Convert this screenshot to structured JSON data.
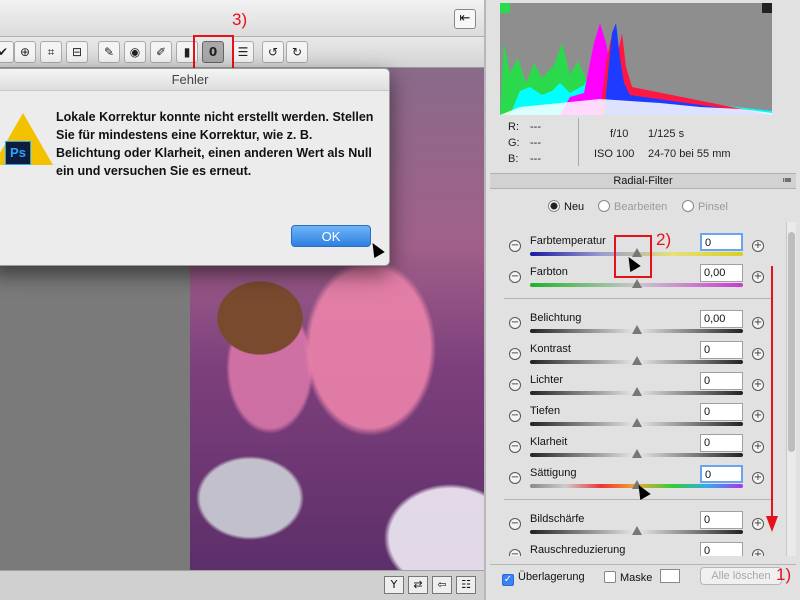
{
  "window": {
    "exit_icon": "⇤"
  },
  "toolbar": {
    "tools": [
      {
        "name": "tool-brush-partial",
        "glyph": "✔"
      },
      {
        "name": "tool-target-adjust",
        "glyph": "⊕"
      },
      {
        "name": "tool-crop",
        "glyph": "⌗"
      },
      {
        "name": "tool-straighten",
        "glyph": "⊟"
      },
      {
        "name": "tool-spot-removal",
        "glyph": "✎"
      },
      {
        "name": "tool-red-eye",
        "glyph": "◉"
      },
      {
        "name": "tool-adjustment-brush",
        "glyph": "✐"
      },
      {
        "name": "tool-graduated-filter",
        "glyph": "▮"
      },
      {
        "name": "tool-radial-filter",
        "glyph": "0"
      },
      {
        "name": "tool-preferences",
        "glyph": "☰"
      },
      {
        "name": "tool-rotate-left",
        "glyph": "↺"
      },
      {
        "name": "tool-rotate-right",
        "glyph": "↻"
      }
    ]
  },
  "annotations": {
    "label_1": "1)",
    "label_2": "2)",
    "label_3": "3)"
  },
  "dialog": {
    "title": "Fehler",
    "message": "Lokale Korrektur konnte nicht erstellt werden. Stellen Sie für mindestens eine Korrektur, wie z. B. Belichtung oder Klarheit, einen anderen Wert als Null ein und versuchen Sie es erneut.",
    "ok_label": "OK",
    "ps_badge": "Ps"
  },
  "status_buttons": [
    "Y",
    "⇄",
    "⇦",
    "☷"
  ],
  "info": {
    "r_label": "R:",
    "r_value": "---",
    "g_label": "G:",
    "g_value": "---",
    "b_label": "B:",
    "b_value": "---",
    "aperture": "f/10",
    "shutter": "1/125 s",
    "iso": "ISO 100",
    "lens": "24-70 bei 55 mm"
  },
  "panel": {
    "title": "Radial-Filter",
    "menu_icon": "≔",
    "modes": [
      {
        "label": "Neu",
        "selected": true,
        "enabled": true
      },
      {
        "label": "Bearbeiten",
        "selected": false,
        "enabled": false
      },
      {
        "label": "Pinsel",
        "selected": false,
        "enabled": false
      }
    ],
    "sliders": [
      {
        "label": "Farbtemperatur",
        "value": "0",
        "level": 0.5,
        "track": "temp",
        "focus": true
      },
      {
        "label": "Farbton",
        "value": "0,00",
        "level": 0.5,
        "track": "tint",
        "focus": false
      },
      {
        "label": "Belichtung",
        "value": "0,00",
        "level": 0.5,
        "track": "gray",
        "focus": false
      },
      {
        "label": "Kontrast",
        "value": "0",
        "level": 0.5,
        "track": "gray",
        "focus": false
      },
      {
        "label": "Lichter",
        "value": "0",
        "level": 0.5,
        "track": "gray",
        "focus": false
      },
      {
        "label": "Tiefen",
        "value": "0",
        "level": 0.5,
        "track": "gray",
        "focus": false
      },
      {
        "label": "Klarheit",
        "value": "0",
        "level": 0.5,
        "track": "gray",
        "focus": false
      },
      {
        "label": "Sättigung",
        "value": "0",
        "level": 0.5,
        "track": "sat",
        "focus": true
      },
      {
        "label": "Bildschärfe",
        "value": "0",
        "level": 0.5,
        "track": "gray",
        "focus": false
      },
      {
        "label": "Rauschreduzierung",
        "value": "0",
        "level": 0.5,
        "track": "gray",
        "focus": false
      }
    ],
    "footer": {
      "overlay_label": "Überlagerung",
      "overlay_checked": true,
      "mask_label": "Maske",
      "mask_checked": false,
      "clear_label": "Alle löschen"
    }
  }
}
